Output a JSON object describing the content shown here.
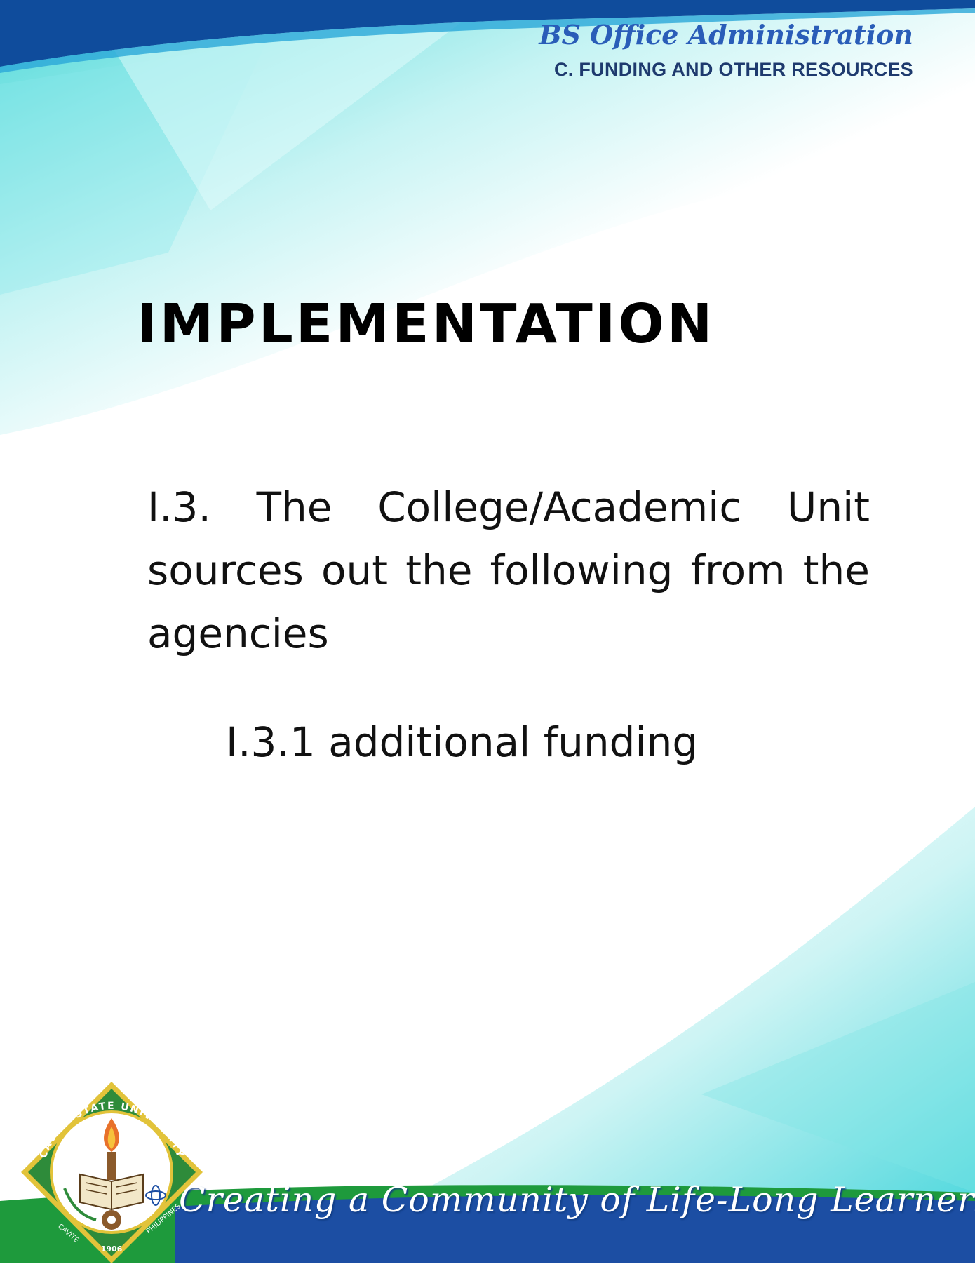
{
  "header": {
    "program": "BS Office Administration",
    "section": "C. FUNDING AND OTHER RESOURCES"
  },
  "title": "IMPLEMENTATION",
  "content": {
    "paragraph": "I.3. The College/Academic Unit sources out the following from the agencies",
    "subitem": "I.3.1 additional funding"
  },
  "footer": {
    "motto": "Creating a Community of Life-Long Learners",
    "seal": {
      "ring_top": "CAVITE STATE UNIVERSITY",
      "ring_bottom_left": "CAVITE",
      "ring_bottom_right": "PHILIPPINES",
      "year": "1906"
    }
  },
  "colors": {
    "header_band": "#0f4c9c",
    "program_text": "#2a5db8",
    "section_text": "#1e3a6e",
    "footer_green": "#1e9a3c",
    "footer_blue": "#1c4ea3",
    "seal_green": "#2e8b3a"
  }
}
